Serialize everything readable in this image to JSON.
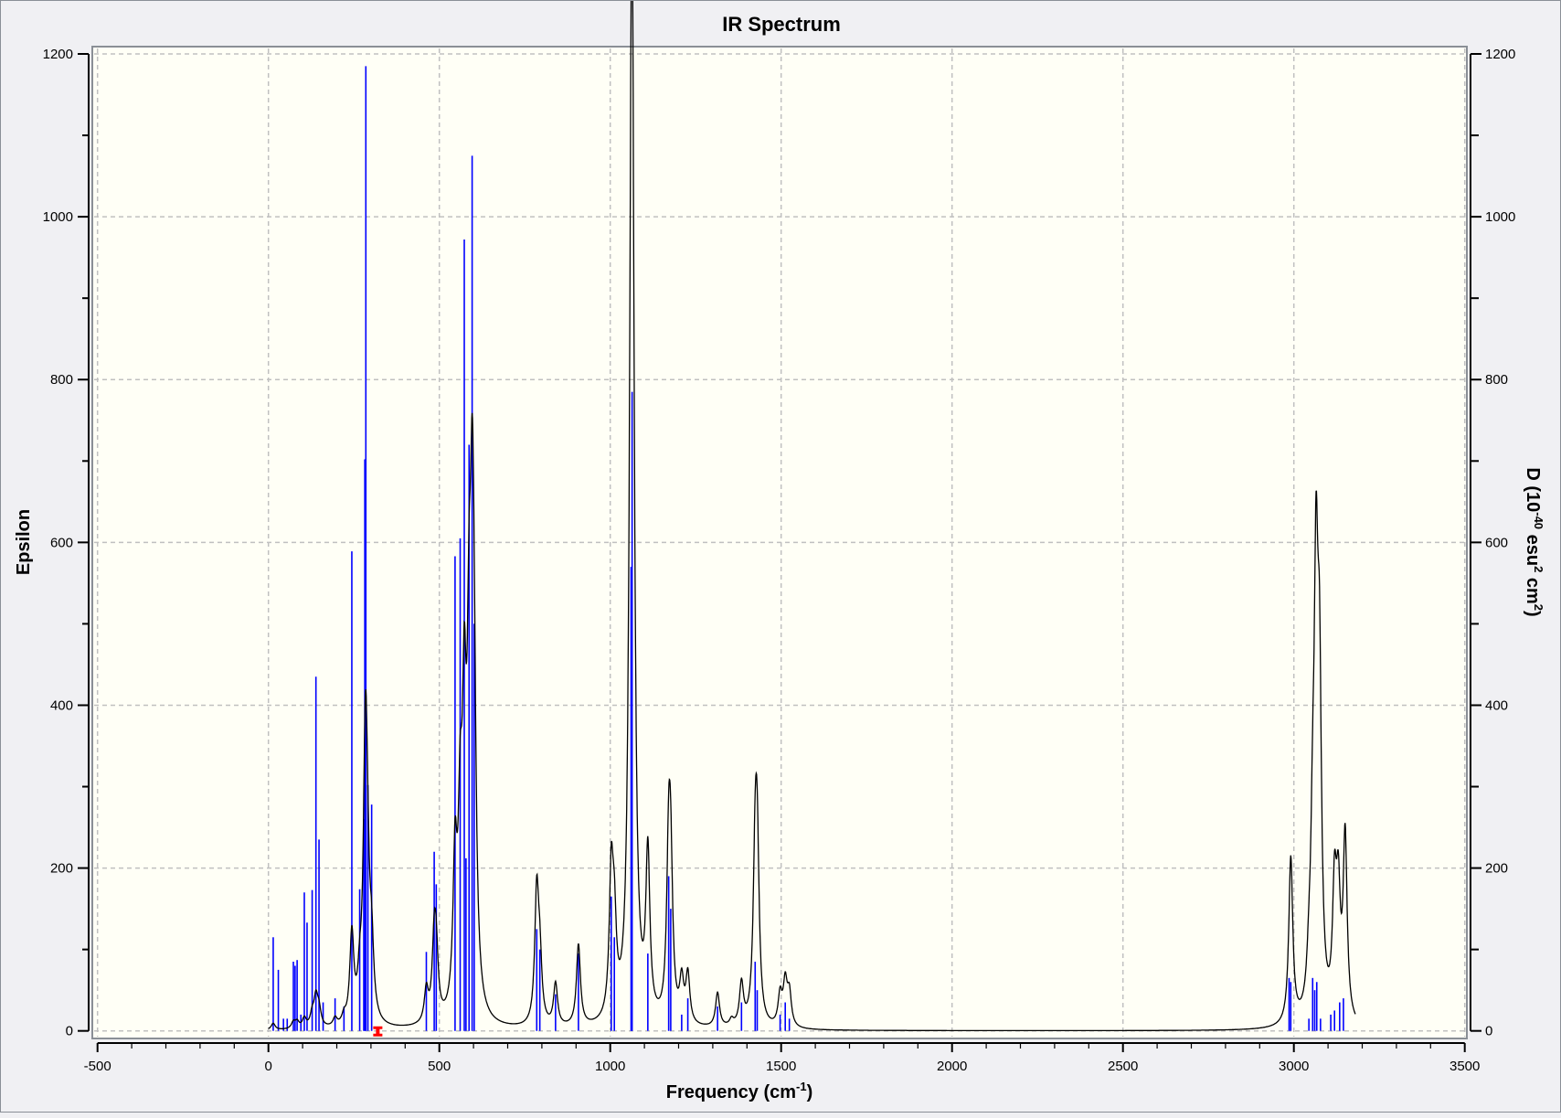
{
  "chart_data": {
    "type": "line",
    "title": "IR Spectrum",
    "xlabel": "Frequency (cm",
    "xlabel_sup": "-1",
    "xlabel_end": ")",
    "ylabel": "Epsilon",
    "y2label_parts": [
      "D (10",
      "-40",
      " esu",
      "2",
      " cm",
      "2",
      ")"
    ],
    "xlim": [
      -500,
      3500
    ],
    "ylim": [
      0,
      1200
    ],
    "y2lim": [
      0,
      1200
    ],
    "xticks": [
      -500,
      0,
      500,
      1000,
      1500,
      2000,
      2500,
      3000,
      3500
    ],
    "yticks": [
      0,
      200,
      400,
      600,
      800,
      1000,
      1200
    ],
    "grid": true,
    "colors": {
      "curve": "#000000",
      "sticks": "#0000ff",
      "marker": "#ff0000",
      "plot_bg": "#fffff6",
      "grid": "#c0c0c0"
    },
    "marker_frequency": 320,
    "sticks_name": "D (intensity sticks, right axis)",
    "sticks": [
      [
        14,
        115
      ],
      [
        29,
        75
      ],
      [
        44,
        15
      ],
      [
        55,
        15
      ],
      [
        73,
        85
      ],
      [
        78,
        80
      ],
      [
        84,
        87
      ],
      [
        95,
        20
      ],
      [
        105,
        170
      ],
      [
        113,
        133
      ],
      [
        128,
        173
      ],
      [
        139,
        435
      ],
      [
        148,
        235
      ],
      [
        160,
        35
      ],
      [
        195,
        40
      ],
      [
        221,
        30
      ],
      [
        244,
        589
      ],
      [
        267,
        174
      ],
      [
        279,
        260
      ],
      [
        282,
        702
      ],
      [
        285,
        1185
      ],
      [
        291,
        302
      ],
      [
        302,
        278
      ],
      [
        462,
        97
      ],
      [
        485,
        220
      ],
      [
        491,
        180
      ],
      [
        546,
        583
      ],
      [
        561,
        605
      ],
      [
        573,
        972
      ],
      [
        578,
        212
      ],
      [
        587,
        720
      ],
      [
        596,
        1075
      ],
      [
        602,
        500
      ],
      [
        785,
        125
      ],
      [
        794,
        100
      ],
      [
        840,
        45
      ],
      [
        907,
        95
      ],
      [
        1003,
        165
      ],
      [
        1012,
        115
      ],
      [
        1061,
        570
      ],
      [
        1064,
        785
      ],
      [
        1110,
        95
      ],
      [
        1171,
        190
      ],
      [
        1177,
        150
      ],
      [
        1209,
        20
      ],
      [
        1227,
        40
      ],
      [
        1314,
        30
      ],
      [
        1384,
        35
      ],
      [
        1424,
        85
      ],
      [
        1430,
        50
      ],
      [
        1497,
        20
      ],
      [
        1512,
        35
      ],
      [
        1524,
        15
      ],
      [
        2986,
        65
      ],
      [
        2991,
        60
      ],
      [
        3044,
        15
      ],
      [
        3055,
        65
      ],
      [
        3061,
        50
      ],
      [
        3067,
        60
      ],
      [
        3078,
        15
      ],
      [
        3108,
        20
      ],
      [
        3119,
        25
      ],
      [
        3134,
        35
      ],
      [
        3145,
        40
      ]
    ],
    "curve_name": "Epsilon (broadened spectrum, left axis)",
    "curve_hwhm": 7,
    "curve_components": [
      [
        14,
        8
      ],
      [
        73,
        8
      ],
      [
        84,
        8
      ],
      [
        105,
        12
      ],
      [
        128,
        15
      ],
      [
        139,
        35
      ],
      [
        148,
        20
      ],
      [
        195,
        10
      ],
      [
        221,
        10
      ],
      [
        244,
        110
      ],
      [
        267,
        40
      ],
      [
        282,
        120
      ],
      [
        285,
        250
      ],
      [
        291,
        80
      ],
      [
        302,
        80
      ],
      [
        462,
        40
      ],
      [
        485,
        90
      ],
      [
        491,
        70
      ],
      [
        546,
        180
      ],
      [
        561,
        200
      ],
      [
        573,
        320
      ],
      [
        587,
        330
      ],
      [
        596,
        450
      ],
      [
        602,
        250
      ],
      [
        785,
        160
      ],
      [
        794,
        70
      ],
      [
        840,
        52
      ],
      [
        907,
        100
      ],
      [
        1003,
        170
      ],
      [
        1012,
        100
      ],
      [
        1061,
        600
      ],
      [
        1065,
        860
      ],
      [
        1110,
        200
      ],
      [
        1171,
        190
      ],
      [
        1177,
        160
      ],
      [
        1209,
        50
      ],
      [
        1227,
        60
      ],
      [
        1314,
        42
      ],
      [
        1355,
        8
      ],
      [
        1384,
        52
      ],
      [
        1424,
        180
      ],
      [
        1430,
        190
      ],
      [
        1497,
        38
      ],
      [
        1512,
        52
      ],
      [
        1524,
        40
      ],
      [
        2991,
        205
      ],
      [
        3044,
        40
      ],
      [
        3055,
        160
      ],
      [
        3065,
        480
      ],
      [
        3075,
        360
      ],
      [
        3119,
        150
      ],
      [
        3130,
        140
      ],
      [
        3150,
        225
      ]
    ],
    "curve_range": [
      0,
      3180
    ]
  }
}
